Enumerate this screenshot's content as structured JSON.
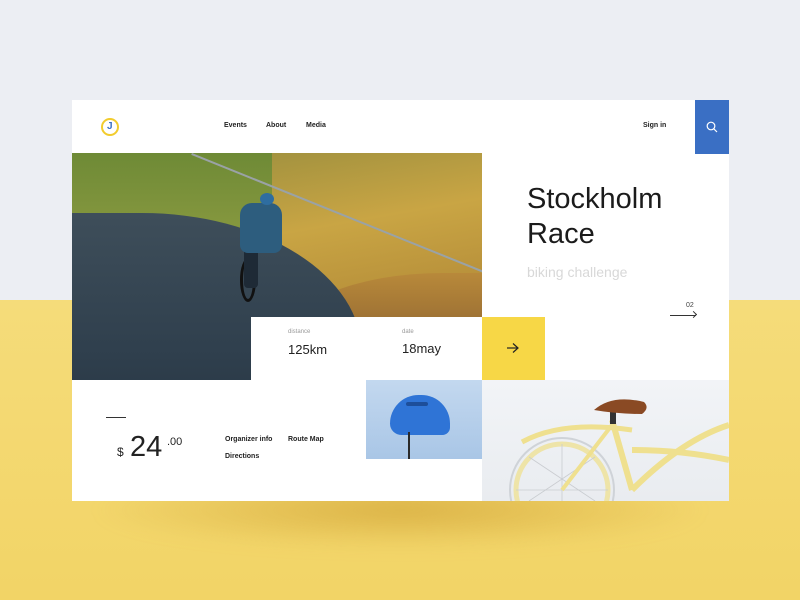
{
  "header": {
    "logo_letter": "J",
    "nav": [
      "Events",
      "About",
      "Media"
    ],
    "sign_in": "Sign in"
  },
  "hero": {
    "title_line1": "Stockholm",
    "title_line2": "Race",
    "subtitle": "biking challenge",
    "page_number": "02"
  },
  "stats": {
    "distance_label": "distance",
    "distance_value": "125km",
    "date_label": "date",
    "date_value": "18may"
  },
  "price": {
    "currency": "$",
    "amount": "24",
    "cents": ".00"
  },
  "links": {
    "organizer": "Organizer info",
    "route": "Route Map",
    "directions": "Directions"
  },
  "colors": {
    "accent_blue": "#3a6fc4",
    "accent_yellow": "#f7d746"
  },
  "icons": [
    "logo-icon",
    "search-icon",
    "arrow-right-icon",
    "pager-arrow-icon"
  ]
}
